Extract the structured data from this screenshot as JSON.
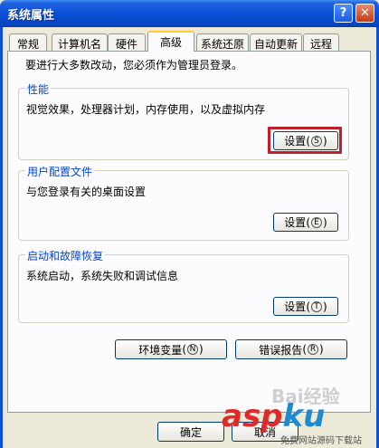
{
  "window": {
    "title": "系统属性"
  },
  "titlebar": {
    "help_glyph": "?",
    "close_glyph": "✕"
  },
  "tabs": [
    {
      "label": "常规"
    },
    {
      "label": "计算机名"
    },
    {
      "label": "硬件"
    },
    {
      "label": "高级",
      "active": true
    },
    {
      "label": "系统还原"
    },
    {
      "label": "自动更新"
    },
    {
      "label": "远程"
    }
  ],
  "advanced": {
    "admin_note": "要进行大多数改动，您必须作为管理员登录。",
    "performance": {
      "title": "性能",
      "description": "视觉效果，处理器计划，内存使用，以及虚拟内存",
      "button_label": "设置",
      "button_accel": "S"
    },
    "user_profiles": {
      "title": "用户配置文件",
      "description": "与您登录有关的桌面设置",
      "button_label": "设置",
      "button_accel": "E"
    },
    "startup_recovery": {
      "title": "启动和故障恢复",
      "description": "系统启动，系统失败和调试信息",
      "button_label": "设置",
      "button_accel": "T"
    },
    "env_button": {
      "label": "环境变量",
      "accel": "N"
    },
    "error_button": {
      "label": "错误报告",
      "accel": "R"
    }
  },
  "footer": {
    "ok_label": "确定",
    "cancel_label": "取消"
  },
  "watermark": {
    "main": "asp",
    "ku": "ku",
    "sub": "免费网站源码下载站",
    "baidu": "Bai经验"
  },
  "colors": {
    "accent": "#0a4fd6",
    "highlight": "#c0202a",
    "group_title": "#0046d5"
  }
}
